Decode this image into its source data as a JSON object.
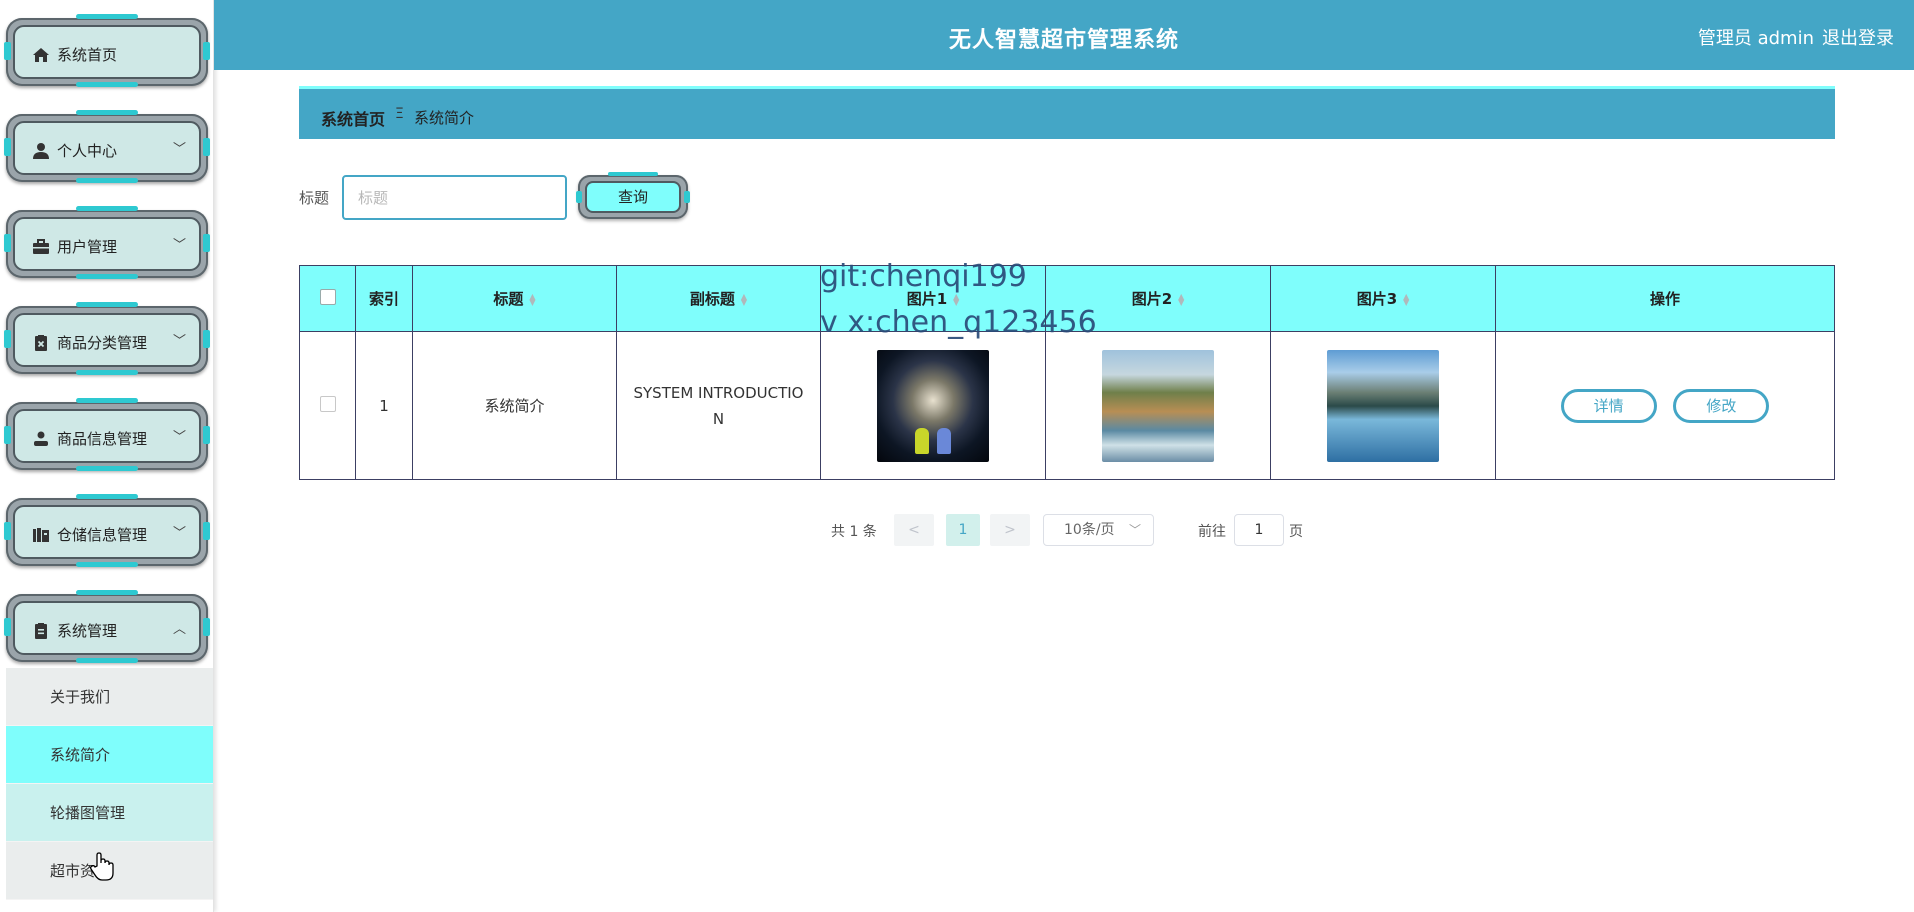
{
  "header": {
    "title": "无人智慧超市管理系统",
    "user": "管理员 admin",
    "logout": "退出登录"
  },
  "sidebar": {
    "items": [
      {
        "label": "系统首页",
        "icon": "home-icon",
        "chevron": ""
      },
      {
        "label": "个人中心",
        "icon": "user-icon",
        "chevron": "﹀"
      },
      {
        "label": "用户管理",
        "icon": "briefcase-icon",
        "chevron": "﹀"
      },
      {
        "label": "商品分类管理",
        "icon": "clipboard-x-icon",
        "chevron": "﹀"
      },
      {
        "label": "商品信息管理",
        "icon": "person-icon",
        "chevron": "﹀"
      },
      {
        "label": "仓储信息管理",
        "icon": "books-icon",
        "chevron": "﹀"
      },
      {
        "label": "系统管理",
        "icon": "clipboard-icon",
        "chevron": "︿"
      }
    ],
    "submenu": [
      {
        "label": "关于我们"
      },
      {
        "label": "系统简介"
      },
      {
        "label": "轮播图管理"
      },
      {
        "label": "超市资讯"
      }
    ]
  },
  "breadcrumb": {
    "home": "系统首页",
    "separator": "Ξ",
    "current": "系统简介"
  },
  "search": {
    "label": "标题",
    "placeholder": "标题",
    "button": "查询"
  },
  "table": {
    "columns": [
      "索引",
      "标题",
      "副标题",
      "图片1",
      "图片2",
      "图片3",
      "操作"
    ],
    "rows": [
      {
        "index": "1",
        "title": "系统简介",
        "subtitle": "SYSTEM INTRODUCTIO N",
        "actions": {
          "detail": "详情",
          "edit": "修改"
        }
      }
    ]
  },
  "pagination": {
    "total": "共 1 条",
    "prev": "<",
    "current_page": "1",
    "next": ">",
    "page_size": "10条/页",
    "goto_label": "前往",
    "goto_value": "1",
    "page_suffix": "页"
  },
  "watermark": {
    "line1": "git:chenqi199",
    "line2": "v x:chen_q123456"
  },
  "colors": {
    "header": "#44a6c6",
    "accent": "#7ffefc",
    "menu_inner": "#cfe8e6"
  }
}
